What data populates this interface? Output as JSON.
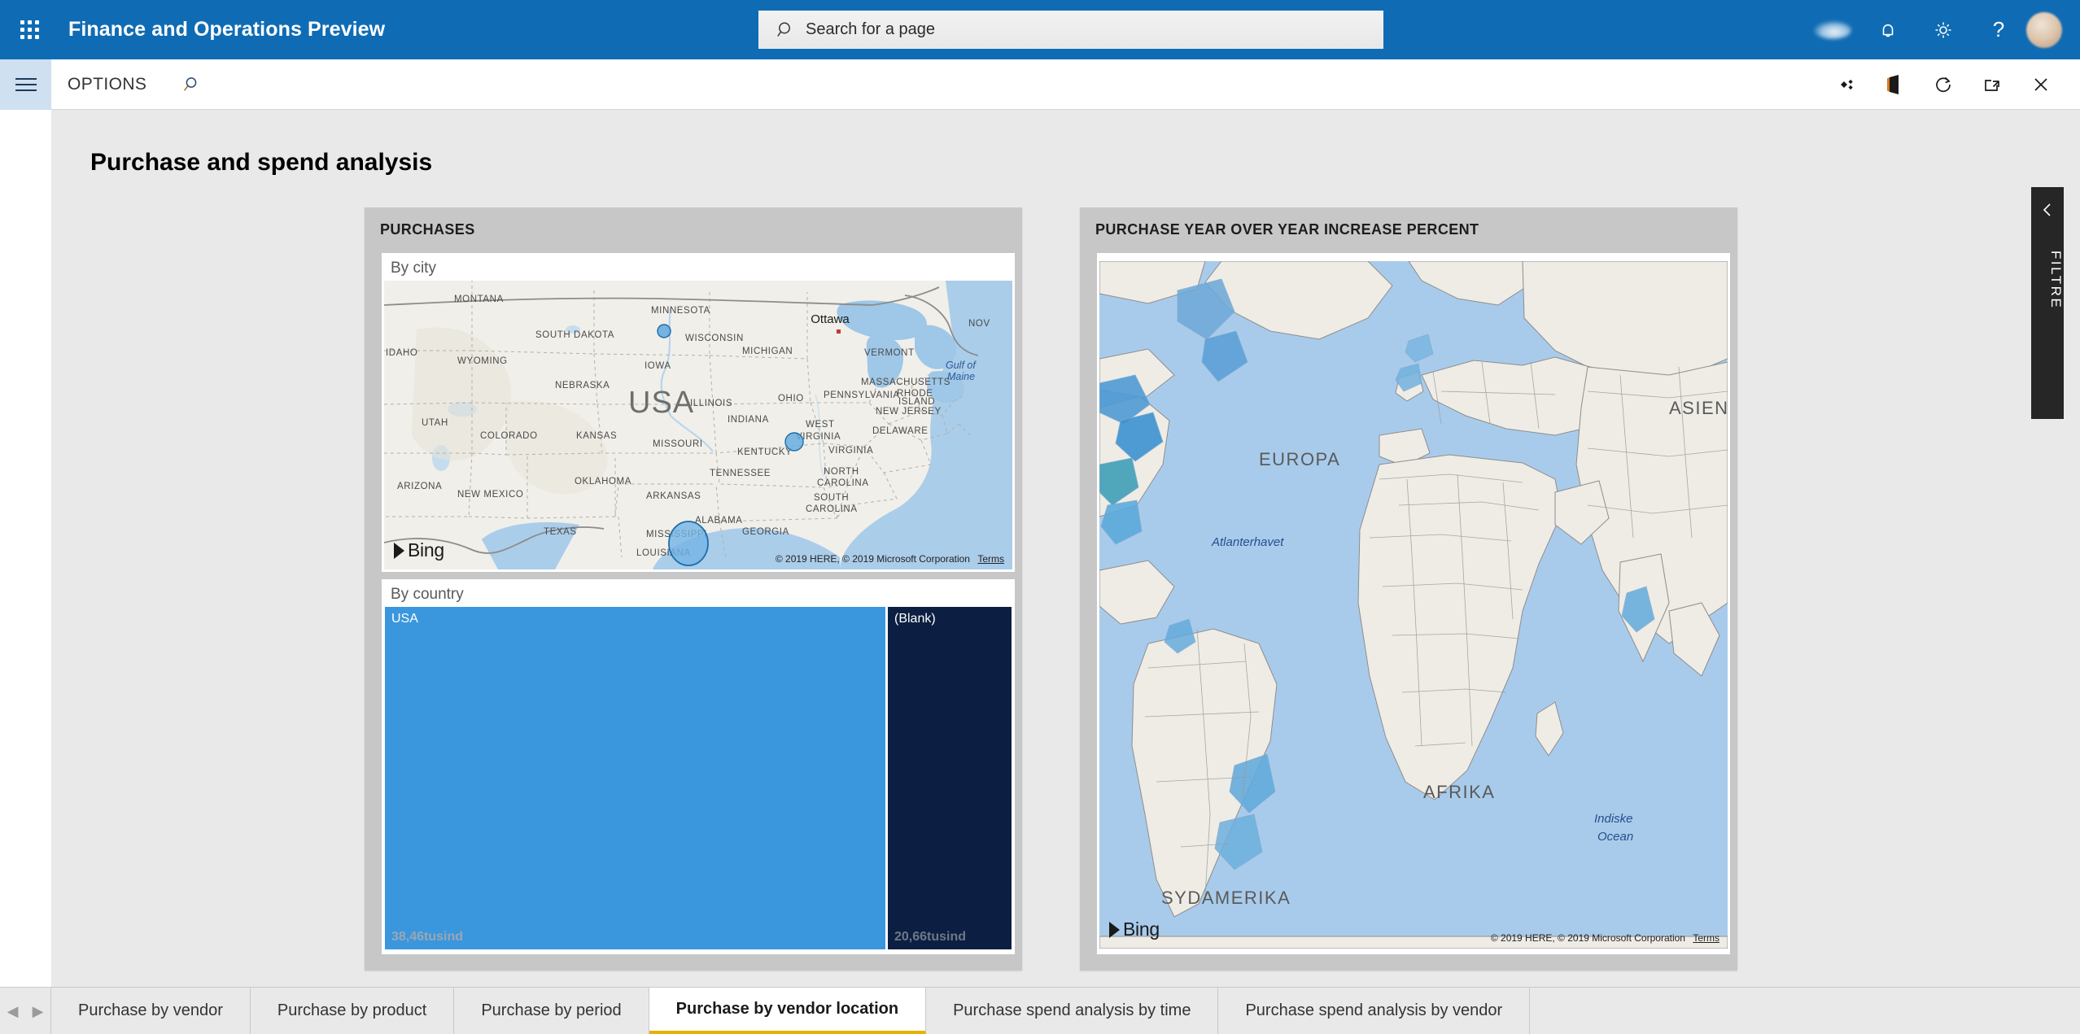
{
  "header": {
    "app_title": "Finance and Operations Preview",
    "waffle_icon": "app-launcher-icon",
    "search": {
      "placeholder": "Search for a page",
      "value": "",
      "icon": "search-icon"
    },
    "icons": [
      {
        "name": "cloud-icon",
        "glyph": ""
      },
      {
        "name": "notification-bell-icon",
        "glyph": "bell"
      },
      {
        "name": "settings-gear-icon",
        "glyph": "gear"
      },
      {
        "name": "help-question-icon",
        "glyph": "?"
      }
    ],
    "avatar_name": "user-avatar"
  },
  "toolbar": {
    "menu_icon": "hamburger-menu-icon",
    "options_label": "OPTIONS",
    "search_icon": "search-icon",
    "right_icons": [
      {
        "name": "shapes-diamond-icon"
      },
      {
        "name": "office-app-icon"
      },
      {
        "name": "refresh-icon"
      },
      {
        "name": "open-in-new-window-icon"
      },
      {
        "name": "close-icon"
      }
    ]
  },
  "page": {
    "title": "Purchase and spend analysis"
  },
  "panels": [
    {
      "title": "PURCHASES",
      "tiles": [
        {
          "label": "By city",
          "type": "map"
        },
        {
          "label": "By country",
          "type": "treemap"
        }
      ]
    },
    {
      "title": "PURCHASE YEAR OVER YEAR INCREASE PERCENT",
      "tiles": [
        {
          "label": "",
          "type": "map"
        }
      ]
    }
  ],
  "map_usa": {
    "attribution": "© 2019 HERE, © 2019 Microsoft Corporation",
    "terms_label": "Terms",
    "bing_label": "Bing",
    "state_labels": [
      "MONTANA",
      "MINNESOTA",
      "WISCONSIN",
      "IDAHO",
      "SOUTH DAKOTA",
      "WYOMING",
      "MICHIGAN",
      "NEBRASKA",
      "IOWA",
      "UTAH",
      "COLORADO",
      "KANSAS",
      "MISSOURI",
      "ILLINOIS",
      "INDIANA",
      "OHIO",
      "PENNSYLVANIA",
      "NEW JERSEY",
      "DELAWARE",
      "WEST VIRGINIA",
      "VIRGINIA",
      "KENTUCKY",
      "TENNESSEE",
      "NORTH CAROLINA",
      "SOUTH CAROLINA",
      "ARIZONA",
      "NEW MEXICO",
      "OKLAHOMA",
      "ARKANSAS",
      "ALABAMA",
      "MISSISSIPPI",
      "GEORGIA",
      "TEXAS",
      "LOUISIANA",
      "VERMONT",
      "MASSACHUSETTS",
      "RHODE ISLAND",
      "NOV"
    ],
    "country_label": "USA",
    "city_markers": [
      {
        "label": "Ottawa",
        "type": "capital"
      },
      {
        "label": "",
        "type": "bubble",
        "size": "small"
      },
      {
        "label": "",
        "type": "bubble",
        "size": "medium"
      },
      {
        "label": "",
        "type": "bubble",
        "size": "large"
      }
    ],
    "water_labels": [
      "Gulf of Maine"
    ]
  },
  "map_world": {
    "attribution": "© 2019 HERE, © 2019 Microsoft Corporation",
    "terms_label": "Terms",
    "bing_label": "Bing",
    "continent_labels": [
      "EUROPA",
      "ASIEN",
      "AFRIKA",
      "SYDAMERIKA"
    ],
    "ocean_labels": [
      "Atlanterhavet",
      "Indiske Ocean"
    ]
  },
  "chart_data": {
    "type": "treemap",
    "title": "By country",
    "categories": [
      "USA",
      "(Blank)"
    ],
    "value_labels": [
      "38,46tusind",
      "20,66tusind"
    ],
    "values": [
      38460,
      20660
    ],
    "colors": [
      "#3a96dd",
      "#0c1f42"
    ],
    "xlabel": "",
    "ylabel": "",
    "legend": "none"
  },
  "filter_panel": {
    "label": "FILTRE",
    "collapse_icon": "chevron-left-icon"
  },
  "tabs": {
    "prev_icon": "chevron-left-icon",
    "next_icon": "chevron-right-icon",
    "items": [
      {
        "label": "Purchase by vendor",
        "active": false
      },
      {
        "label": "Purchase by product",
        "active": false
      },
      {
        "label": "Purchase by period",
        "active": false
      },
      {
        "label": "Purchase by vendor location",
        "active": true
      },
      {
        "label": "Purchase spend analysis by time",
        "active": false
      },
      {
        "label": "Purchase spend analysis by vendor",
        "active": false
      }
    ]
  },
  "colors": {
    "brand_blue": "#0f6cb4",
    "accent_yellow": "#e8b100",
    "treemap_primary": "#3a96dd",
    "treemap_secondary": "#0c1f42",
    "panel_gray": "#c7c7c7",
    "canvas_gray": "#e9e9e9"
  }
}
